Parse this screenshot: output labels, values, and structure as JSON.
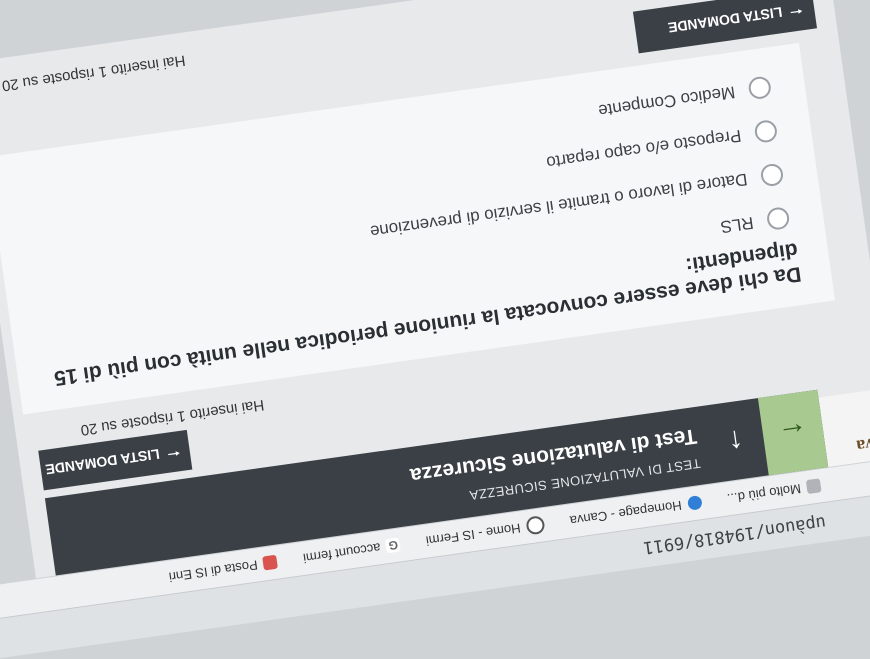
{
  "browser": {
    "url": "upàuon/194818/6911",
    "bookmarks": [
      {
        "label": "Molto più d...",
        "icon": "page-icon"
      },
      {
        "label": "Homepage - Canva",
        "icon": "canva-icon"
      },
      {
        "label": "Home - IS Fermi",
        "icon": "globe-icon"
      },
      {
        "label": "account fermi",
        "icon": "google-icon"
      },
      {
        "label": "Posta di IS Enri",
        "icon": "mail-icon"
      }
    ]
  },
  "header": {
    "logo_text": "tova",
    "subtitle": "TEST DI VALUTAZIONE SICUREZZA",
    "title": "Test di valutazione Sicurezza"
  },
  "list_button_label": "LISTA DOMANDE",
  "progress_top": "Hai inserito 1 risposte su 20",
  "question": {
    "text": "Da chi deve essere convocata la riunione periodica nelle unità con più di 15 dipendenti:",
    "options": [
      "RLS",
      "Datore di lavoro o tramite il servizio di prevenzione",
      "Preposto e/o capo reparto",
      "Medico Compente"
    ]
  },
  "progress_bottom": "Hai inserito 1 risposte su 20"
}
